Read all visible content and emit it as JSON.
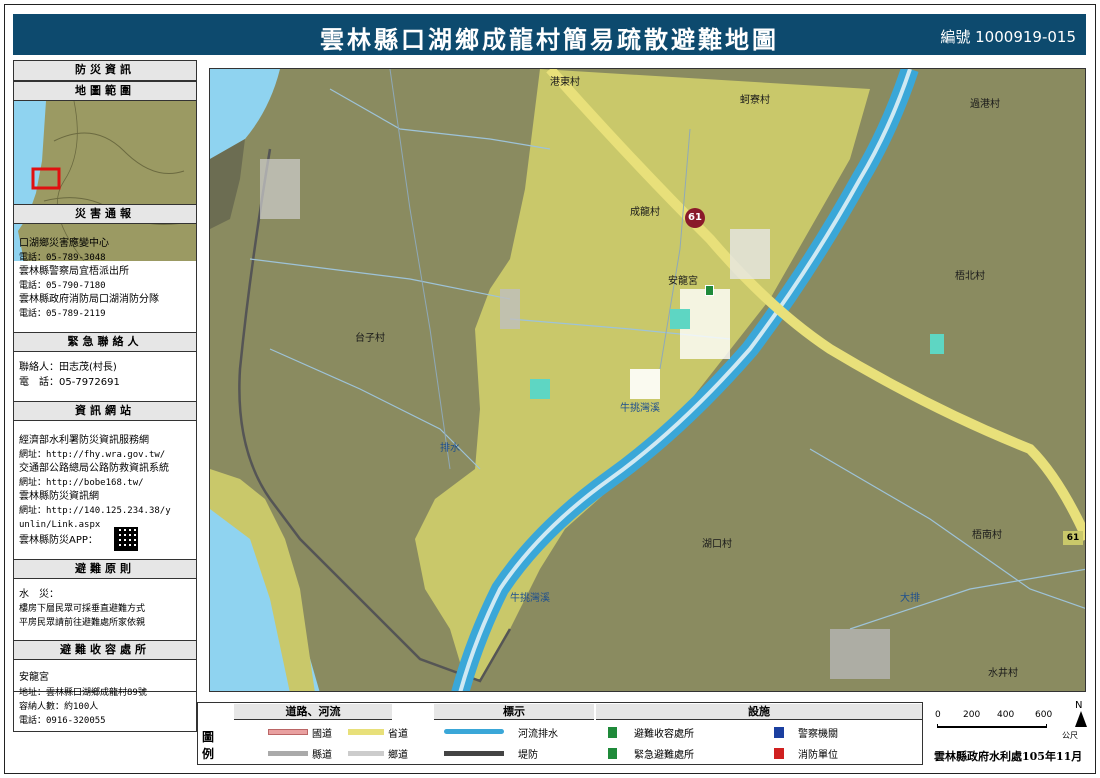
{
  "title": "雲林縣口湖鄉成龍村簡易疏散避難地圖",
  "code": "編號 1000919-015",
  "sidebar": {
    "header_info": "防災資訊",
    "header_range": "地圖範圍",
    "header_contact": "災害通報",
    "contacts": [
      {
        "name": "口湖鄉災害應變中心",
        "phone": "電話：05-789-3048"
      },
      {
        "name": "雲林縣警察局宜梧派出所",
        "phone": "電話：05-790-7180"
      },
      {
        "name": "雲林縣政府消防局口湖消防分隊",
        "phone": "電話：05-789-2119"
      }
    ],
    "header_emergency": "緊急聯絡人",
    "emergency_contact": "聯絡人：田志茂(村長)",
    "emergency_phone": "電　話：05-7972691",
    "header_web": "資訊網站",
    "sites": [
      {
        "name": "經濟部水利署防災資訊服務網",
        "url": "網址：http://fhy.wra.gov.tw/"
      },
      {
        "name": "交通部公路總局公路防救資訊系統",
        "url": "網址：http://bobe168.tw/"
      },
      {
        "name": "雲林縣防災資訊網",
        "url": "網址：http://140.125.234.38/y",
        "url2": "unlin/Link.aspx"
      }
    ],
    "app_label": "雲林縣防災APP：",
    "header_principle": "避難原則",
    "principle_title": "水　災：",
    "principle_lines": [
      "樓房下層民眾可採垂直避難方式",
      "平房民眾請前往避難處所家依親"
    ],
    "header_shelter": "避難收容處所",
    "shelter_name": "安龍宮",
    "shelter_address": "地址：雲林縣口湖鄉成龍村89號",
    "shelter_capacity": "容納人數：約100人",
    "shelter_phone": "電話：0916-320055"
  },
  "map_labels": {
    "village_main": "成龍村",
    "temple": "安龍宮",
    "gangdong": "港東村",
    "keliao": "蚵寮村",
    "guogang": "過港村",
    "wuzhu": "梧北村",
    "taizi": "台子村",
    "hukou": "湖口村",
    "wunan": "梧南村",
    "shuijing": "水井村",
    "route_61": "61",
    "river1": "牛挑灣溪",
    "river2": "牛挑灣溪",
    "drain1": "排水",
    "drain2": "大排"
  },
  "legend": {
    "title": "圖　例",
    "col1_header": "道路、河流",
    "col2_header": "標示",
    "col3_header": "設施",
    "national_road": "國道",
    "provincial_road": "省道",
    "county_road": "縣道",
    "township_road": "鄉道",
    "river": "河流排水",
    "levee": "堤防",
    "shelter": "避難收容處所",
    "temp_shelter": "緊急避難處所",
    "police": "警察機關",
    "fire": "消防單位"
  },
  "scale": {
    "ticks": [
      "0",
      "200",
      "400",
      "600"
    ],
    "unit": "公尺"
  },
  "north": "N",
  "credit": "雲林縣政府水利處105年11月",
  "colors": {
    "title_bg": "#0d4a6e",
    "village_fill": "#c9c86a",
    "land": "#8a8b60",
    "sea": "#8fd3f0",
    "river": "#3aa7d8",
    "highway": "#e8e07a"
  }
}
